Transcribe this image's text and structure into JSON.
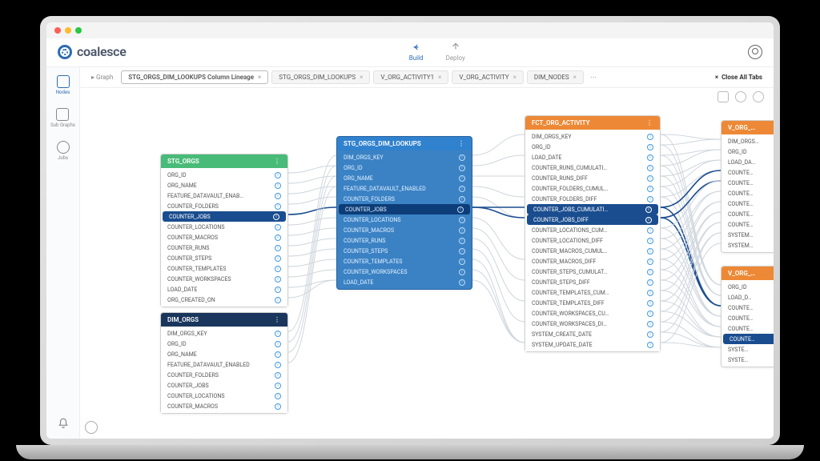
{
  "brand": "coalesce",
  "top_nav": {
    "build": "Build",
    "deploy": "Deploy"
  },
  "sidebar": {
    "items": [
      {
        "label": "Nodes"
      },
      {
        "label": "Sub Graphs"
      },
      {
        "label": "Jobs"
      }
    ]
  },
  "tabs": {
    "prefix": "Graph",
    "items": [
      {
        "label": "STG_ORGS_DIM_LOOKUPS Column Lineage",
        "active": true
      },
      {
        "label": "STG_ORGS_DIM_LOOKUPS"
      },
      {
        "label": "V_ORG_ACTIVITY1"
      },
      {
        "label": "V_ORG_ACTIVITY"
      },
      {
        "label": "DIM_NODES"
      }
    ],
    "close_all": "Close All Tabs"
  },
  "nodes": {
    "stg_orgs": {
      "title": "STG_ORGS",
      "cols": [
        "ORG_ID",
        "ORG_NAME",
        "FEATURE_DATAVAULT_ENAB…",
        "COUNTER_FOLDERS",
        "COUNTER_JOBS",
        "COUNTER_LOCATIONS",
        "COUNTER_MACROS",
        "COUNTER_RUNS",
        "COUNTER_STEPS",
        "COUNTER_TEMPLATES",
        "COUNTER_WORKSPACES",
        "LOAD_DATE",
        "ORG_CREATED_ON"
      ],
      "sel": 4
    },
    "dim_orgs": {
      "title": "DIM_ORGS",
      "cols": [
        "DIM_ORGS_KEY",
        "ORG_ID",
        "ORG_NAME",
        "FEATURE_DATAVAULT_ENABLED",
        "COUNTER_FOLDERS",
        "COUNTER_JOBS",
        "COUNTER_LOCATIONS",
        "COUNTER_MACROS"
      ]
    },
    "lookups": {
      "title": "STG_ORGS_DIM_LOOKUPS",
      "cols": [
        "DIM_ORGS_KEY",
        "ORG_ID",
        "ORG_NAME",
        "FEATURE_DATAVAULT_ENABLED",
        "COUNTER_FOLDERS",
        "COUNTER_JOBS",
        "COUNTER_LOCATIONS",
        "COUNTER_MACROS",
        "COUNTER_RUNS",
        "COUNTER_STEPS",
        "COUNTER_TEMPLATES",
        "COUNTER_WORKSPACES",
        "LOAD_DATE"
      ],
      "sel": 5
    },
    "fct": {
      "title": "FCT_ORG_ACTIVITY",
      "cols": [
        "DIM_ORGS_KEY",
        "ORG_ID",
        "LOAD_DATE",
        "COUNTER_RUNS_CUMULATI…",
        "COUNTER_RUNS_DIFF",
        "COUNTER_FOLDERS_CUMUL…",
        "COUNTER_FOLDERS_DIFF",
        "COUNTER_JOBS_CUMULATI…",
        "COUNTER_JOBS_DIFF",
        "COUNTER_LOCATIONS_CUM…",
        "COUNTER_LOCATIONS_DIFF",
        "COUNTER_MACROS_CUMUL…",
        "COUNTER_MACROS_DIFF",
        "COUNTER_STEPS_CUMULAT…",
        "COUNTER_STEPS_DIFF",
        "COUNTER_TEMPLATES_CUM…",
        "COUNTER_TEMPLATES_DIFF",
        "COUNTER_WORKSPACES_CU…",
        "COUNTER_WORKSPACES_DI…",
        "SYSTEM_CREATE_DATE",
        "SYSTEM_UPDATE_DATE"
      ],
      "sel": [
        7,
        8
      ]
    },
    "v1": {
      "title": "V_ORG_…",
      "cols": [
        "DIM_ORGS…",
        "ORG_ID",
        "LOAD_DA…",
        "COUNTE…",
        "COUNTE…",
        "COUNTE…",
        "COUNTE…",
        "COUNTE…",
        "COUNTE…",
        "SYSTEM…",
        "SYSTEM…"
      ]
    },
    "v2": {
      "title": "V_ORG_…",
      "cols": [
        "ORG_ID",
        "LOAD_D…",
        "COUNTE…",
        "COUNTE…",
        "COUNTE…",
        "COUNTE…",
        "SYSTE…",
        "SYSTE…"
      ],
      "sel": 5
    }
  }
}
